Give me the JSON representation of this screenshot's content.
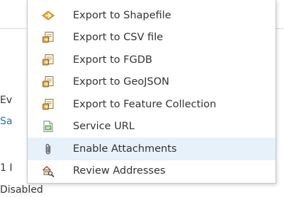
{
  "background": {
    "row_ev": "Ev",
    "row_sa": "Sa",
    "row_one": "1 I",
    "row_disabled": "Disabled"
  },
  "menu": {
    "items": [
      {
        "label": "Export to Shapefile",
        "icon": "shapefile-icon"
      },
      {
        "label": "Export to CSV file",
        "icon": "export-doc-icon"
      },
      {
        "label": "Export to FGDB",
        "icon": "export-doc-icon"
      },
      {
        "label": "Export to GeoJSON",
        "icon": "export-doc-icon"
      },
      {
        "label": "Export to Feature Collection",
        "icon": "export-doc-icon"
      },
      {
        "label": "Service URL",
        "icon": "service-url-icon"
      },
      {
        "label": "Enable Attachments",
        "icon": "paperclip-icon"
      },
      {
        "label": "Review Addresses",
        "icon": "review-addresses-icon"
      }
    ],
    "highlighted_index": 6
  },
  "colors": {
    "highlight": "#e6f1fa",
    "link": "#2a6fb0",
    "text": "#333333",
    "border": "#c7c7c7"
  }
}
